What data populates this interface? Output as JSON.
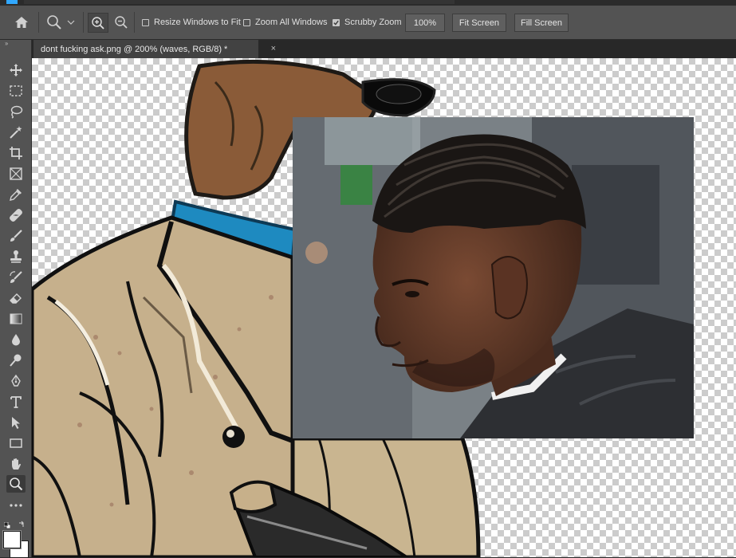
{
  "options_bar": {
    "resize_windows_label": "Resize Windows to Fit",
    "resize_windows_checked": false,
    "zoom_all_label": "Zoom All Windows",
    "zoom_all_checked": false,
    "scrubby_zoom_label": "Scrubby Zoom",
    "scrubby_zoom_checked": true,
    "zoom_100_label": "100%",
    "fit_screen_label": "Fit Screen",
    "fill_screen_label": "Fill Screen"
  },
  "document_tab": {
    "title": "dont fucking ask.png @ 200% (waves, RGB/8) *",
    "close_glyph": "×"
  },
  "toolbar": {
    "collapse_glyph": "››",
    "tools": [
      "move",
      "marquee",
      "lasso",
      "magic-wand",
      "crop",
      "frame",
      "eyedropper",
      "healing-brush",
      "brush",
      "clone-stamp",
      "history-brush",
      "eraser",
      "gradient",
      "blur",
      "dodge",
      "pen",
      "type",
      "path-selection",
      "rectangle",
      "hand",
      "zoom",
      "more"
    ],
    "active_tool": "zoom",
    "foreground_color": "#ffffff",
    "background_color": "#ffffff"
  },
  "colors": {
    "app_bg": "#282828",
    "panel": "#535353",
    "accent": "#31a8ff"
  }
}
